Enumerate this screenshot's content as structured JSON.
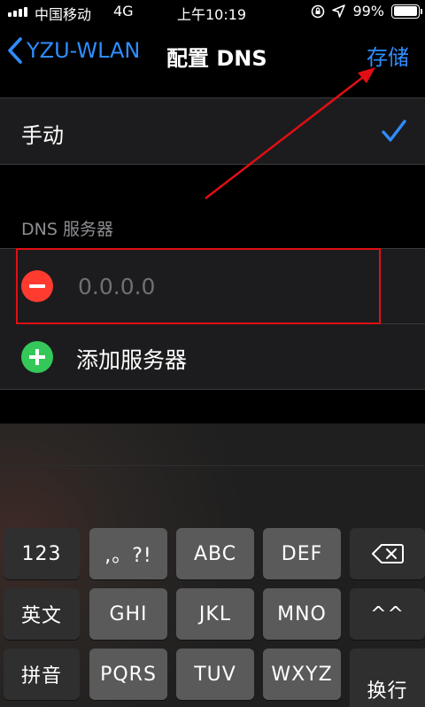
{
  "status_bar": {
    "carrier": "中国移动",
    "network": "4G",
    "time": "上午10:19",
    "battery": "99%",
    "battery_level": 0.99
  },
  "nav": {
    "back_label": "YZU-WLAN",
    "title": "配置 DNS",
    "save_label": "存储"
  },
  "manual": {
    "label": "手动"
  },
  "dns": {
    "section_header": "DNS 服务器",
    "placeholder": "0.0.0.0",
    "add_label": "添加服务器"
  },
  "keyboard": {
    "row1": [
      "123",
      ",。?!",
      "ABC",
      "DEF"
    ],
    "row2": [
      "英文",
      "GHI",
      "JKL",
      "MNO",
      "^^"
    ],
    "row3": [
      "拼音",
      "PQRS",
      "TUV",
      "WXYZ"
    ],
    "enter": "换行"
  },
  "colors": {
    "accent": "#2f8dff",
    "delete": "#ff3b30",
    "add": "#34c759",
    "annotation": "#e10e14"
  },
  "icons": [
    "back-chevron-icon",
    "checkmark-icon",
    "minus-circle-icon",
    "plus-circle-icon",
    "backspace-icon",
    "location-icon",
    "rotation-lock-icon"
  ]
}
